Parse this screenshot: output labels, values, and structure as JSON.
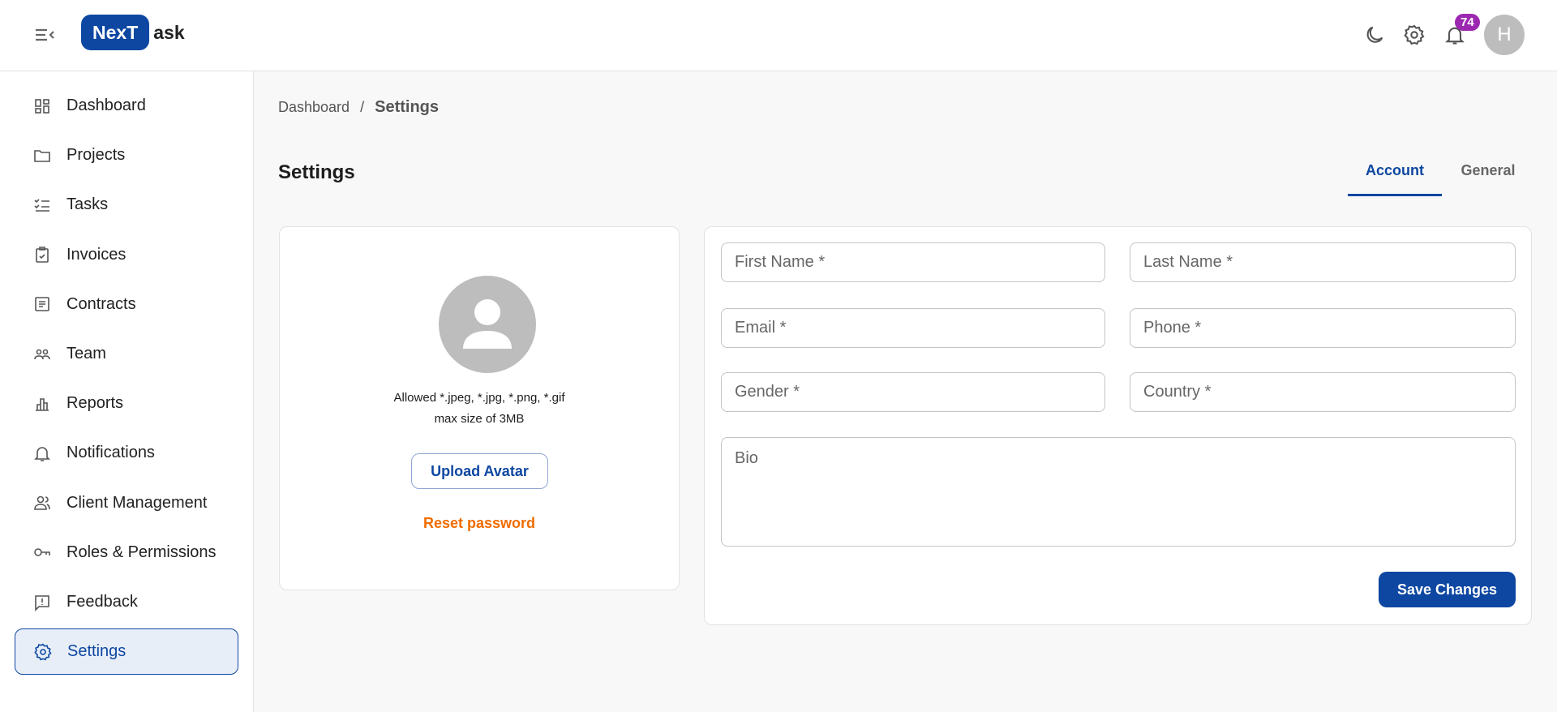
{
  "header": {
    "logo_box": "NexT",
    "logo_rest": "ask",
    "notification_count": "74",
    "avatar_initial": "H"
  },
  "sidebar": {
    "items": [
      {
        "label": "Dashboard",
        "icon": "dashboard-icon"
      },
      {
        "label": "Projects",
        "icon": "folder-icon"
      },
      {
        "label": "Tasks",
        "icon": "checklist-icon"
      },
      {
        "label": "Invoices",
        "icon": "clipboard-check-icon"
      },
      {
        "label": "Contracts",
        "icon": "document-icon"
      },
      {
        "label": "Team",
        "icon": "team-icon"
      },
      {
        "label": "Reports",
        "icon": "bar-chart-icon"
      },
      {
        "label": "Notifications",
        "icon": "bell-icon"
      },
      {
        "label": "Client Management",
        "icon": "users-icon"
      },
      {
        "label": "Roles & Permissions",
        "icon": "key-icon"
      },
      {
        "label": "Feedback",
        "icon": "feedback-icon"
      },
      {
        "label": "Settings",
        "icon": "gear-icon",
        "active": true
      }
    ]
  },
  "breadcrumb": {
    "parent": "Dashboard",
    "separator": "/",
    "current": "Settings"
  },
  "page": {
    "title": "Settings",
    "tabs": [
      {
        "label": "Account",
        "active": true
      },
      {
        "label": "General"
      }
    ]
  },
  "avatar_card": {
    "allowed": "Allowed *.jpeg, *.jpg, *.png, *.gif",
    "max_size": "max size of 3MB",
    "upload_label": "Upload Avatar",
    "reset_label": "Reset password"
  },
  "form": {
    "first_name": "First Name *",
    "last_name": "Last Name *",
    "email": "Email *",
    "phone": "Phone *",
    "gender": "Gender *",
    "country": "Country *",
    "bio": "Bio",
    "save_label": "Save Changes"
  },
  "colors": {
    "primary": "#0d47a1",
    "badge": "#9c27b0",
    "reset": "#ef6c00"
  }
}
